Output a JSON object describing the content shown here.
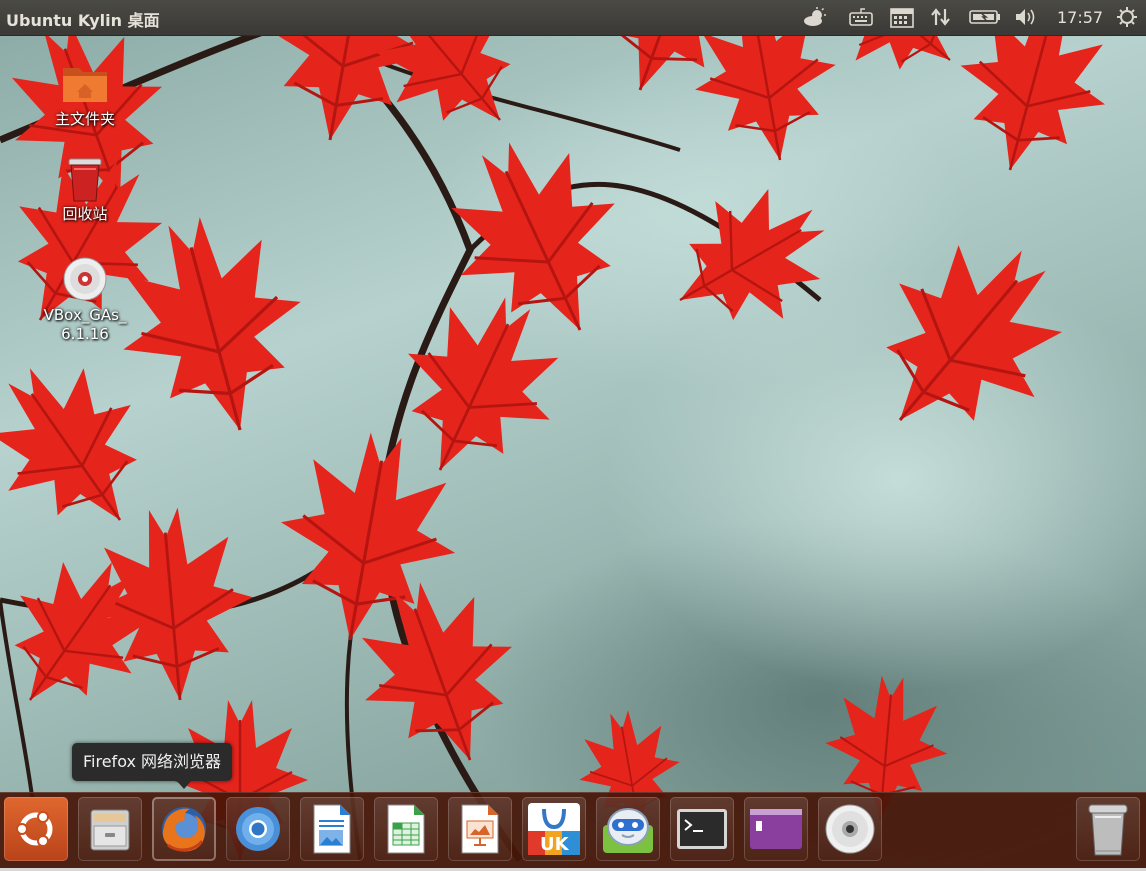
{
  "panel": {
    "title": "Ubuntu Kylin 桌面",
    "clock": "17:57",
    "indicators": [
      "weather-icon",
      "keyboard-icon",
      "calendar-icon",
      "network-icon",
      "battery-icon",
      "volume-icon",
      "power-icon"
    ]
  },
  "desktop": {
    "icons": [
      {
        "label": "主文件夹",
        "icon": "home-folder-icon"
      },
      {
        "label": "回收站",
        "icon": "trash-icon"
      },
      {
        "label": "VBox_GAs_",
        "label2": "6.1.16",
        "icon": "cdrom-icon"
      }
    ]
  },
  "tooltip": {
    "text": "Firefox 网络浏览器"
  },
  "launcher": {
    "items": [
      {
        "name": "dash-home",
        "icon": "ubuntu-logo-icon"
      },
      {
        "name": "files",
        "icon": "file-cabinet-icon"
      },
      {
        "name": "firefox",
        "icon": "firefox-icon"
      },
      {
        "name": "chromium",
        "icon": "chromium-icon"
      },
      {
        "name": "writer",
        "icon": "writer-icon"
      },
      {
        "name": "calc",
        "icon": "calc-icon"
      },
      {
        "name": "impress",
        "icon": "impress-icon"
      },
      {
        "name": "software-center",
        "icon": "uk-software-icon"
      },
      {
        "name": "kylin-assistant",
        "icon": "assistant-icon"
      },
      {
        "name": "terminal",
        "icon": "terminal-icon"
      },
      {
        "name": "workspace-switcher",
        "icon": "workspaces-icon"
      },
      {
        "name": "dvd",
        "icon": "cdrom-icon"
      },
      {
        "name": "trash",
        "icon": "trash-icon"
      }
    ],
    "uk_badge": "UK"
  },
  "colors": {
    "panel": "#3c3b37",
    "launcher": "#46160a",
    "leaf": "#e8231c"
  }
}
